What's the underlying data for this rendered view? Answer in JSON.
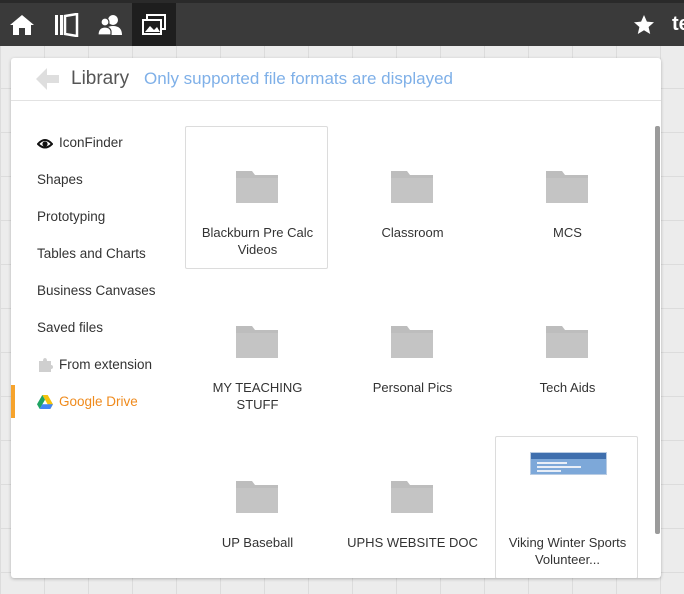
{
  "toolbar": {
    "buttons": [
      {
        "name": "home-button",
        "icon": "home-icon"
      },
      {
        "name": "library-button",
        "icon": "books-icon"
      },
      {
        "name": "users-button",
        "icon": "users-icon"
      },
      {
        "name": "images-button",
        "icon": "images-icon",
        "active": true
      }
    ],
    "star_icon": "star-icon",
    "user_text": "te"
  },
  "dialog": {
    "title": "Library",
    "subtitle": "Only supported file formats are displayed",
    "back_icon": "back-arrow-icon"
  },
  "sidebar": {
    "items": [
      {
        "label": "IconFinder",
        "icon": "iconfinder-icon"
      },
      {
        "label": "Shapes"
      },
      {
        "label": "Prototyping"
      },
      {
        "label": "Tables and Charts"
      },
      {
        "label": "Business Canvases"
      },
      {
        "label": "Saved files"
      },
      {
        "label": "From extension",
        "icon": "puzzle-icon"
      },
      {
        "label": "Google Drive",
        "icon": "google-drive-icon",
        "selected": true
      }
    ]
  },
  "files": [
    {
      "label": "Blackburn Pre Calc Videos",
      "type": "folder",
      "framed": true
    },
    {
      "label": "Classroom",
      "type": "folder"
    },
    {
      "label": "MCS",
      "type": "folder"
    },
    {
      "label": "MY TEACHING STUFF",
      "type": "folder"
    },
    {
      "label": "Personal Pics",
      "type": "folder"
    },
    {
      "label": "Tech Aids",
      "type": "folder"
    },
    {
      "label": "UP Baseball",
      "type": "folder"
    },
    {
      "label": "UPHS WEBSITE DOC",
      "type": "folder"
    },
    {
      "label": "Viking Winter Sports Volunteer...",
      "type": "document",
      "framed": true
    }
  ],
  "colors": {
    "accent": "#f6a32c",
    "subtitle": "#7fb0e8",
    "folder": "#bdbdbd",
    "toolbar": "#3a3a3a"
  }
}
